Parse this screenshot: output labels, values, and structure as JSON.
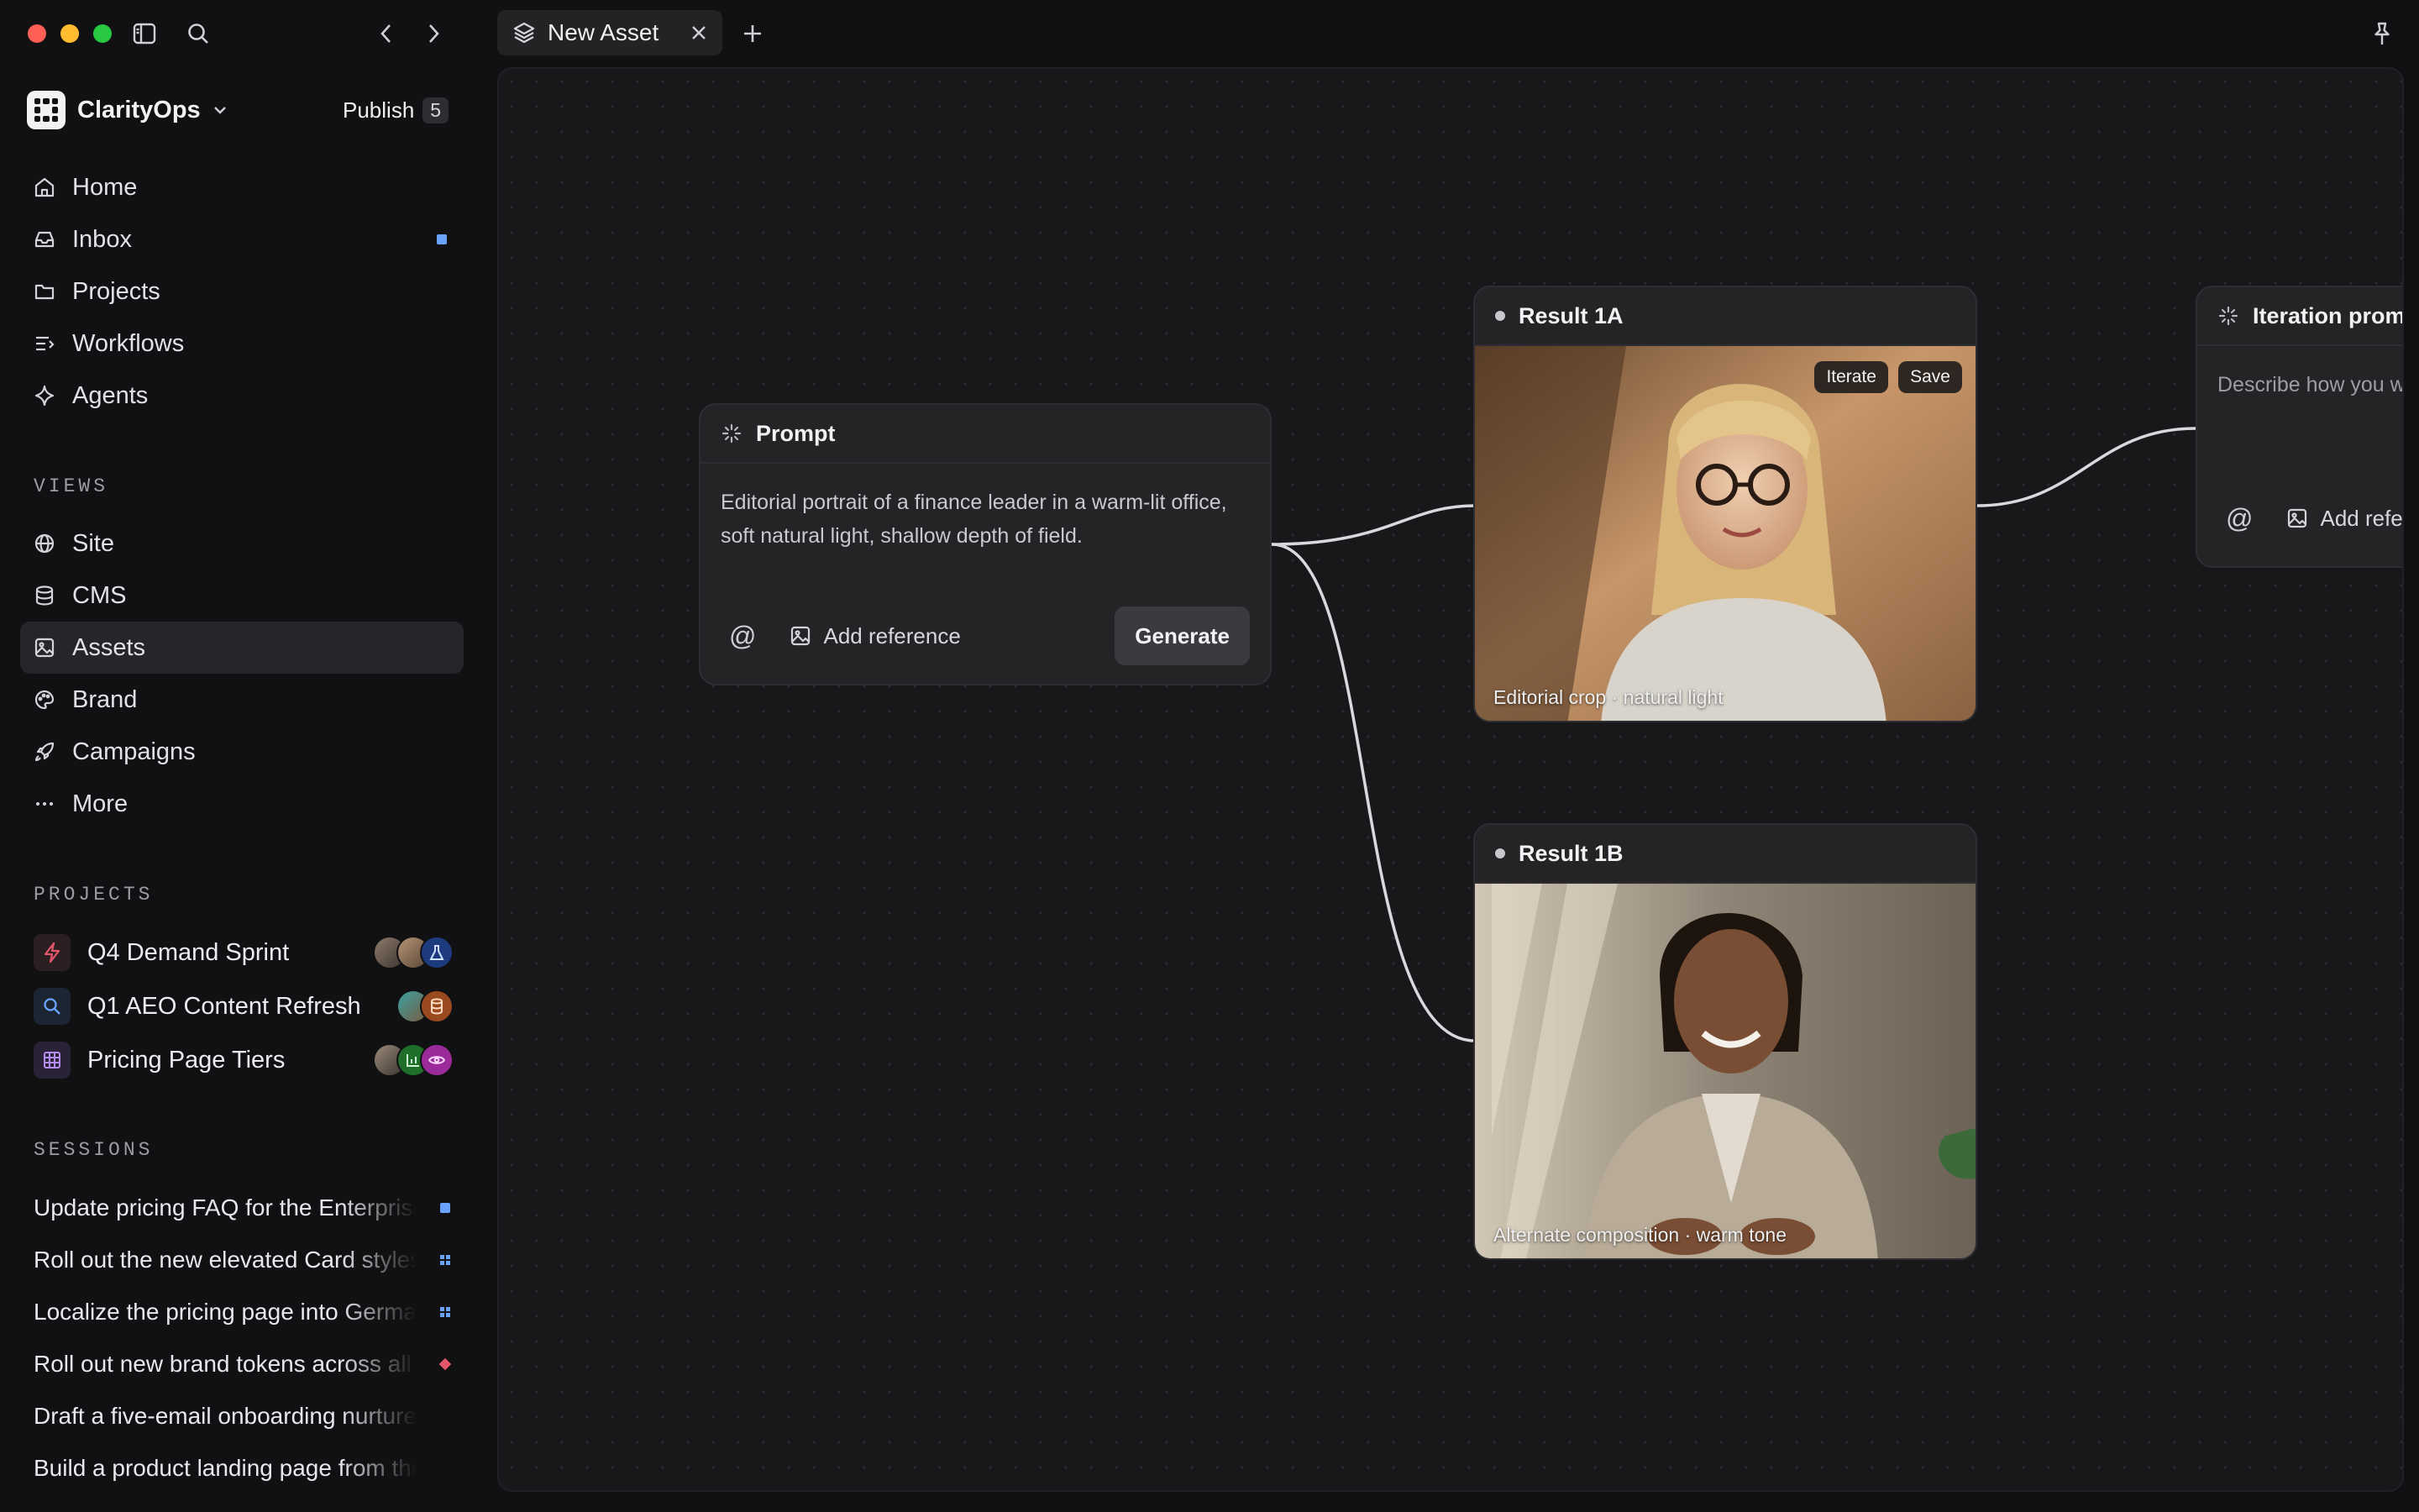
{
  "tab": {
    "title": "New Asset"
  },
  "workspace": {
    "name": "ClarityOps",
    "publish_label": "Publish",
    "publish_count": "5"
  },
  "nav": [
    "Home",
    "Inbox",
    "Projects",
    "Workflows",
    "Agents"
  ],
  "views_heading": "VIEWS",
  "views": [
    "Site",
    "CMS",
    "Assets",
    "Brand",
    "Campaigns",
    "More"
  ],
  "projects_heading": "PROJECTS",
  "projects": [
    {
      "label": "Q4 Demand Sprint"
    },
    {
      "label": "Q1 AEO Content Refresh"
    },
    {
      "label": "Pricing Page Tiers"
    }
  ],
  "sessions_heading": "SESSIONS",
  "sessions": [
    "Update pricing FAQ for the Enterprise",
    "Roll out the new elevated Card styles",
    "Localize the pricing page into German",
    "Roll out new brand tokens across all",
    "Draft a five-email onboarding nurture",
    "Build a product landing page from the"
  ],
  "prompt_node": {
    "title": "Prompt",
    "text": "Editorial portrait of a finance leader in a warm-lit office, soft natural light, shallow depth of field.",
    "at": "@",
    "add_reference": "Add reference",
    "generate": "Generate"
  },
  "result_1a": {
    "title": "Result 1A",
    "iterate": "Iterate",
    "save": "Save",
    "caption": "Editorial crop · natural light"
  },
  "result_1b": {
    "title": "Result 1B",
    "caption": "Alternate composition · warm tone"
  },
  "iteration_node": {
    "title": "Iteration prompt",
    "placeholder": "Describe how you want to iterate",
    "at": "@",
    "add_reference": "Add reference"
  },
  "colors": {
    "accent_blue": "#6aa3ff",
    "accent_red": "#e4576a",
    "background": "#111113",
    "canvas": "#18181b"
  }
}
